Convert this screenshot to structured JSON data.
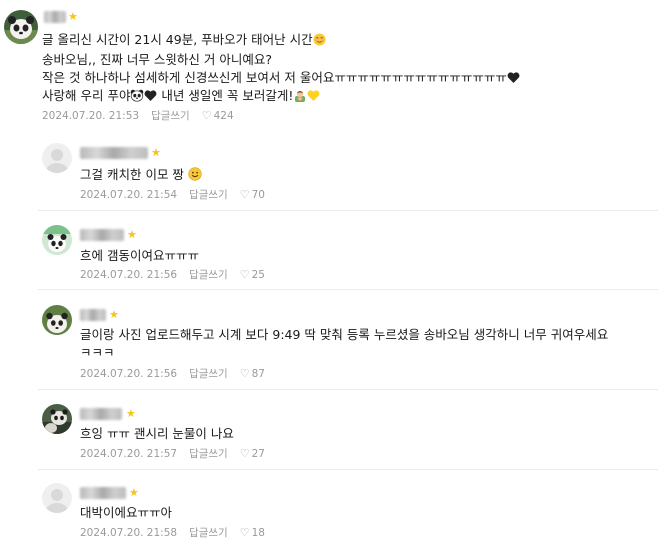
{
  "main_comment": {
    "lines": [
      "글 올리신 시간이 21시 49분, 푸바오가 태어난 시간",
      "송바오님,, 진짜 너무 스윗하신 거 아니예요?",
      "작은 것 하나하나 섬세하게 신경쓰신게 보여서 저 울어요ㅠㅠㅠㅠㅠㅠㅠㅠㅠㅠㅠㅠㅠㅠㅠ",
      "사랑해 우리 푸야",
      " 내년 생일엔 꼭 보러갈게!"
    ],
    "timestamp": "2024.07.20. 21:53",
    "reply_label": "답글쓰기",
    "likes": "424"
  },
  "replies": [
    {
      "text": "그걸 캐치한 이모 짱",
      "timestamp": "2024.07.20. 21:54",
      "reply_label": "답글쓰기",
      "likes": "70"
    },
    {
      "text": "흐에 갬동이여요ㅠㅠㅠ",
      "timestamp": "2024.07.20. 21:56",
      "reply_label": "답글쓰기",
      "likes": "25"
    },
    {
      "text": "글이랑 사진 업로드해두고 시계 보다 9:49 딱 맞춰 등록 누르셨을 송바오님 생각하니 너무 귀여우세요",
      "text2": "ㅋㅋㅋ",
      "timestamp": "2024.07.20. 21:56",
      "reply_label": "답글쓰기",
      "likes": "87"
    },
    {
      "text": "흐잉 ㅠㅠ 괜시리 눈물이 나요",
      "timestamp": "2024.07.20. 21:57",
      "reply_label": "답글쓰기",
      "likes": "27"
    },
    {
      "text": "대박이에요ㅠㅠ아",
      "timestamp": "2024.07.20. 21:58",
      "reply_label": "답글쓰기",
      "likes": "18"
    }
  ],
  "icons": {
    "star": "star-icon",
    "heart": "heart-outline-icon",
    "panda": "panda-face-icon",
    "black_heart": "black-heart-icon",
    "yellow_heart": "yellow-heart-icon",
    "smile": "smiling-face-icon",
    "person_flower": "person-with-flower-icon"
  },
  "colors": {
    "star": "#f5c518",
    "meta": "#9a9a9a",
    "text": "#1a1a1a"
  }
}
